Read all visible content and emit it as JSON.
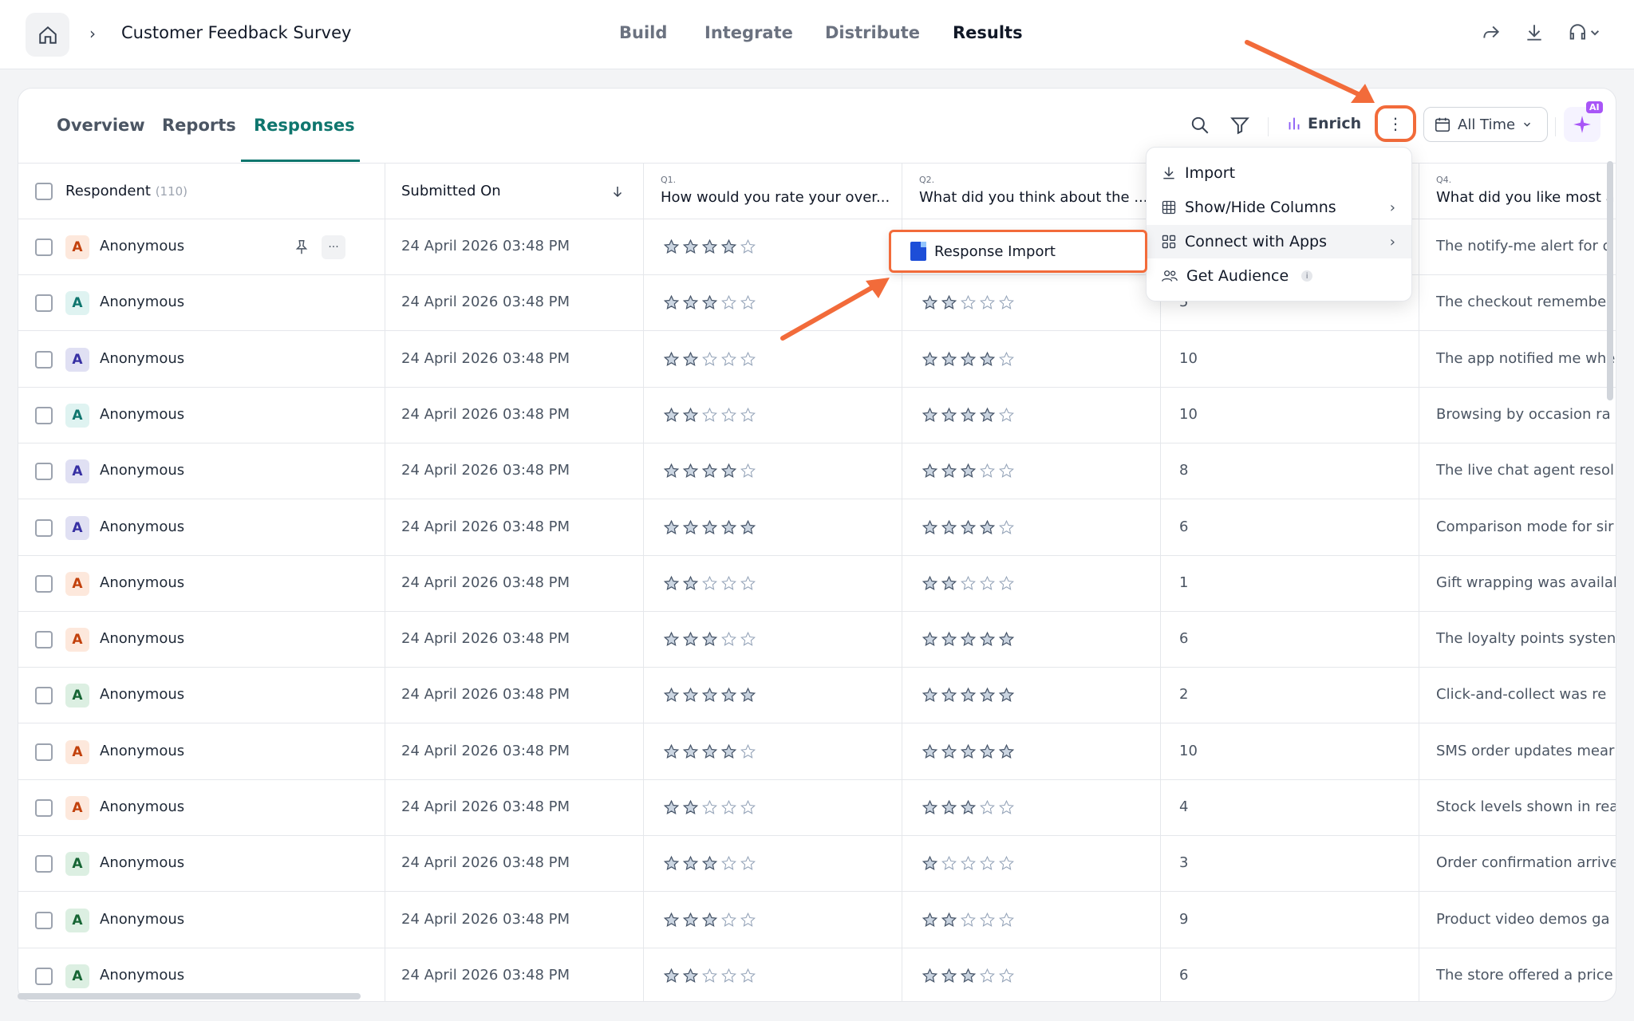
{
  "topbar": {
    "survey_title": "Customer Feedback Survey",
    "nav": [
      {
        "label": "Build",
        "active": false
      },
      {
        "label": "Integrate",
        "active": false
      },
      {
        "label": "Distribute",
        "active": false
      },
      {
        "label": "Results",
        "active": true
      }
    ]
  },
  "subtabs": [
    {
      "label": "Overview",
      "active": false
    },
    {
      "label": "Reports",
      "active": false
    },
    {
      "label": "Responses",
      "active": true
    }
  ],
  "toolbar": {
    "enrich_label": "Enrich",
    "date_filter": "All Time",
    "ai_badge": "AI"
  },
  "menu": {
    "items": [
      {
        "label": "Import",
        "icon": "download-icon",
        "has_submenu": false
      },
      {
        "label": "Show/Hide Columns",
        "icon": "columns-icon",
        "has_submenu": true
      },
      {
        "label": "Connect with Apps",
        "icon": "apps-grid-icon",
        "has_submenu": true
      },
      {
        "label": "Get Audience",
        "icon": "audience-icon",
        "has_submenu": false
      }
    ],
    "submenu_item": "Response Import",
    "info_glyph": "i"
  },
  "table": {
    "respondent_header": "Respondent",
    "respondent_count": "(110)",
    "submitted_header": "Submitted On",
    "questions": [
      {
        "num": "Q1.",
        "text": "How would you rate your over..."
      },
      {
        "num": "Q2.",
        "text": "What did you think about the ..."
      },
      {
        "num": "Q4.",
        "text": "What did you like most a"
      }
    ],
    "rows": [
      {
        "name": "Anonymous",
        "avatar": "A",
        "color": "orange",
        "date": "24 April 2026 03:48 PM",
        "q1": 4,
        "q2": 0,
        "q3": "",
        "q4": "The notify-me alert for o"
      },
      {
        "name": "Anonymous",
        "avatar": "A",
        "color": "teal",
        "date": "24 April 2026 03:48 PM",
        "q1": 3,
        "q2": 2,
        "q3": "5",
        "q4": "The checkout remember"
      },
      {
        "name": "Anonymous",
        "avatar": "A",
        "color": "purple",
        "date": "24 April 2026 03:48 PM",
        "q1": 2,
        "q2": 4,
        "q3": "10",
        "q4": "The app notified me whe"
      },
      {
        "name": "Anonymous",
        "avatar": "A",
        "color": "teal",
        "date": "24 April 2026 03:48 PM",
        "q1": 2,
        "q2": 4,
        "q3": "10",
        "q4": "Browsing by occasion ra"
      },
      {
        "name": "Anonymous",
        "avatar": "A",
        "color": "purple",
        "date": "24 April 2026 03:48 PM",
        "q1": 4,
        "q2": 3,
        "q3": "8",
        "q4": "The live chat agent resol"
      },
      {
        "name": "Anonymous",
        "avatar": "A",
        "color": "purple",
        "date": "24 April 2026 03:48 PM",
        "q1": 5,
        "q2": 4,
        "q3": "6",
        "q4": "Comparison mode for sir"
      },
      {
        "name": "Anonymous",
        "avatar": "A",
        "color": "orange",
        "date": "24 April 2026 03:48 PM",
        "q1": 2,
        "q2": 2,
        "q3": "1",
        "q4": "Gift wrapping was availal"
      },
      {
        "name": "Anonymous",
        "avatar": "A",
        "color": "orange",
        "date": "24 April 2026 03:48 PM",
        "q1": 3,
        "q2": 5,
        "q3": "6",
        "q4": "The loyalty points systen"
      },
      {
        "name": "Anonymous",
        "avatar": "A",
        "color": "green",
        "date": "24 April 2026 03:48 PM",
        "q1": 5,
        "q2": 5,
        "q3": "2",
        "q4": "Click-and-collect was re"
      },
      {
        "name": "Anonymous",
        "avatar": "A",
        "color": "orange",
        "date": "24 April 2026 03:48 PM",
        "q1": 4,
        "q2": 5,
        "q3": "10",
        "q4": "SMS order updates mear"
      },
      {
        "name": "Anonymous",
        "avatar": "A",
        "color": "orange",
        "date": "24 April 2026 03:48 PM",
        "q1": 2,
        "q2": 3,
        "q3": "4",
        "q4": "Stock levels shown in rea"
      },
      {
        "name": "Anonymous",
        "avatar": "A",
        "color": "green",
        "date": "24 April 2026 03:48 PM",
        "q1": 3,
        "q2": 1,
        "q3": "3",
        "q4": "Order confirmation arrive"
      },
      {
        "name": "Anonymous",
        "avatar": "A",
        "color": "green",
        "date": "24 April 2026 03:48 PM",
        "q1": 3,
        "q2": 2,
        "q3": "9",
        "q4": "Product video demos ga"
      },
      {
        "name": "Anonymous",
        "avatar": "A",
        "color": "green",
        "date": "24 April 2026 03:48 PM",
        "q1": 2,
        "q2": 3,
        "q3": "6",
        "q4": "The store offered a price"
      }
    ]
  },
  "colors": {
    "accent": "#0f766e",
    "highlight": "#f26b3a",
    "avatar_orange_bg": "#fde8dc",
    "avatar_orange_fg": "#c2410c",
    "avatar_teal_bg": "#dff3f1",
    "avatar_teal_fg": "#0f766e",
    "avatar_purple_bg": "#e0e0f3",
    "avatar_purple_fg": "#3730a3",
    "avatar_green_bg": "#dcefe2",
    "avatar_green_fg": "#166534"
  }
}
